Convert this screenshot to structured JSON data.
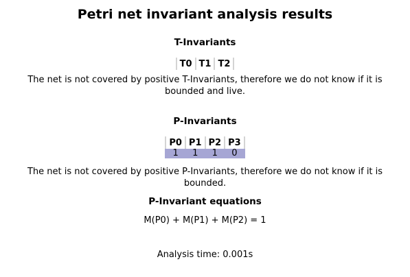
{
  "title": "Petri net invariant analysis results",
  "t_invariants": {
    "heading": "T-Invariants",
    "columns": [
      "T0",
      "T1",
      "T2"
    ],
    "rows": [],
    "message": "The net is not covered by positive T-Invariants, therefore we do not know if it is bounded and live."
  },
  "p_invariants": {
    "heading": "P-Invariants",
    "columns": [
      "P0",
      "P1",
      "P2",
      "P3"
    ],
    "rows": [
      [
        "1",
        "1",
        "1",
        "0"
      ]
    ],
    "message": "The net is not covered by positive P-Invariants, therefore we do not know if it is bounded."
  },
  "equations": {
    "heading": "P-Invariant equations",
    "items": [
      "M(P0) + M(P1) + M(P2) = 1"
    ]
  },
  "analysis_time": "Analysis time: 0.001s",
  "colors": {
    "row_highlight": "#a6a6d4",
    "cell_border": "#d4d4d4"
  }
}
